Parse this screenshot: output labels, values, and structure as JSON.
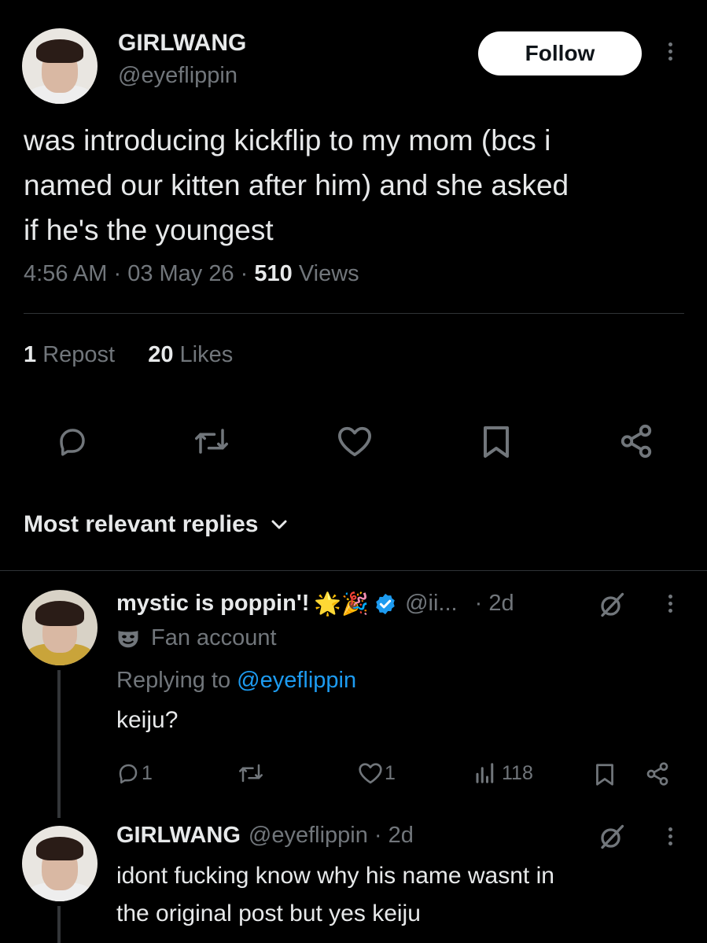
{
  "tweet": {
    "author_name": "GIRLWANG",
    "author_handle": "@eyeflippin",
    "follow_label": "Follow",
    "text_lines": [
      "was introducing kickflip to my mom (bcs i",
      "named our kitten after him) and she asked",
      "if he's the youngest"
    ],
    "time": "4:56 AM",
    "date": "03 May 26",
    "views_count": "510",
    "views_label": "Views",
    "reposts_count": "1",
    "reposts_label": "Repost",
    "likes_count": "20",
    "likes_label": "Likes"
  },
  "replies_header": "Most relevant replies",
  "replies": [
    {
      "name": "mystic is poppin'!",
      "emojis": "🌟🎉",
      "handle": "@ii...",
      "time": "· 2d",
      "badge_label": "Fan account",
      "replying_prefix": "Replying to",
      "replying_handle": "@eyeflippin",
      "text": "keiju?",
      "reply_count": "1",
      "repost_count": "",
      "like_count": "1",
      "views": "118"
    },
    {
      "name": "GIRLWANG",
      "handle": "@eyeflippin",
      "time": "· 2d",
      "text_lines": [
        "idont fucking know why his name wasnt in",
        "the original post but yes keiju"
      ]
    }
  ],
  "colors": {
    "background": "#000000",
    "text": "#e7e9ea",
    "muted": "#71767b",
    "link": "#1d9bf0",
    "divider": "#2f3336"
  }
}
